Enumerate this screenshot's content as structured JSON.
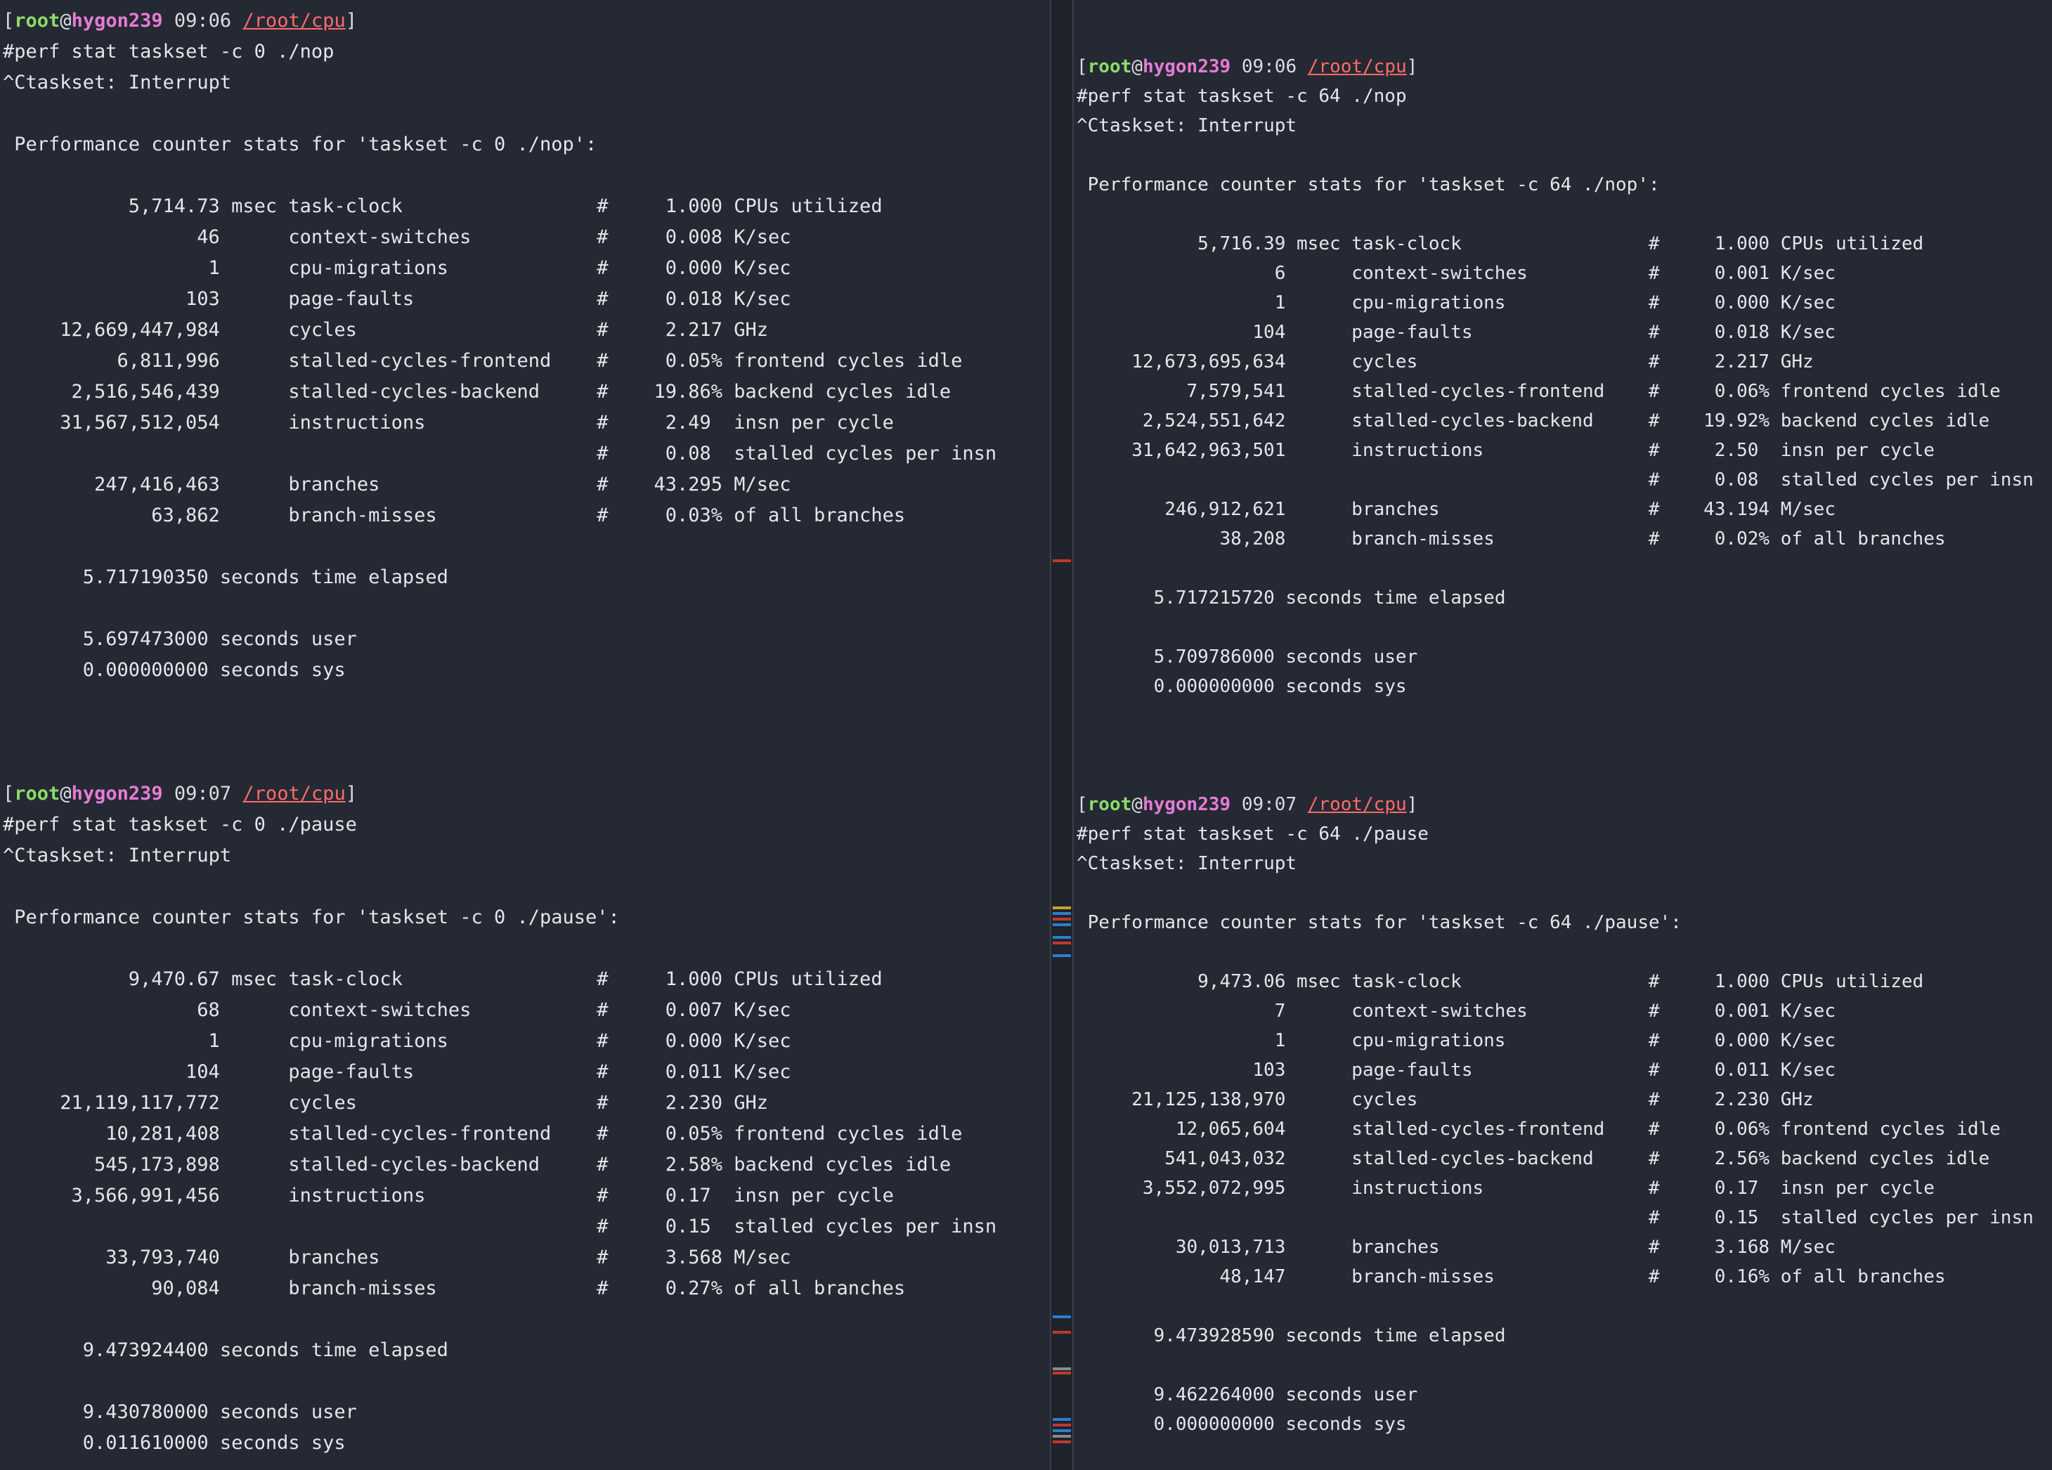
{
  "prompt": {
    "user": "root",
    "at": "@",
    "host": "hygon239",
    "path": "/root/cpu"
  },
  "panes": [
    {
      "runs": [
        {
          "time": "09:06",
          "command": "#perf stat taskset -c 0 ./nop",
          "interrupt": "^Ctaskset: Interrupt",
          "header": " Performance counter stats for 'taskset -c 0 ./nop':",
          "rows": [
            {
              "value": "5,714.73",
              "unit": "msec",
              "event": "task-clock",
              "hash": "#",
              "metric": "1.000",
              "desc": "CPUs utilized"
            },
            {
              "value": "46",
              "unit": "",
              "event": "context-switches",
              "hash": "#",
              "metric": "0.008",
              "desc": "K/sec"
            },
            {
              "value": "1",
              "unit": "",
              "event": "cpu-migrations",
              "hash": "#",
              "metric": "0.000",
              "desc": "K/sec"
            },
            {
              "value": "103",
              "unit": "",
              "event": "page-faults",
              "hash": "#",
              "metric": "0.018",
              "desc": "K/sec"
            },
            {
              "value": "12,669,447,984",
              "unit": "",
              "event": "cycles",
              "hash": "#",
              "metric": "2.217",
              "desc": "GHz"
            },
            {
              "value": "6,811,996",
              "unit": "",
              "event": "stalled-cycles-frontend",
              "hash": "#",
              "metric": "0.05%",
              "desc": "frontend cycles idle"
            },
            {
              "value": "2,516,546,439",
              "unit": "",
              "event": "stalled-cycles-backend",
              "hash": "#",
              "metric": "19.86%",
              "desc": "backend cycles idle"
            },
            {
              "value": "31,567,512,054",
              "unit": "",
              "event": "instructions",
              "hash": "#",
              "metric": "2.49",
              "desc": "insn per cycle"
            },
            {
              "value": "",
              "unit": "",
              "event": "",
              "hash": "#",
              "metric": "0.08",
              "desc": "stalled cycles per insn"
            },
            {
              "value": "247,416,463",
              "unit": "",
              "event": "branches",
              "hash": "#",
              "metric": "43.295",
              "desc": "M/sec"
            },
            {
              "value": "63,862",
              "unit": "",
              "event": "branch-misses",
              "hash": "#",
              "metric": "0.03%",
              "desc": "of all branches"
            }
          ],
          "elapsed": "5.717190350 seconds time elapsed",
          "user": "5.697473000 seconds user",
          "sys": "0.000000000 seconds sys"
        },
        {
          "time": "09:07",
          "command": "#perf stat taskset -c 0 ./pause",
          "interrupt": "^Ctaskset: Interrupt",
          "header": " Performance counter stats for 'taskset -c 0 ./pause':",
          "rows": [
            {
              "value": "9,470.67",
              "unit": "msec",
              "event": "task-clock",
              "hash": "#",
              "metric": "1.000",
              "desc": "CPUs utilized"
            },
            {
              "value": "68",
              "unit": "",
              "event": "context-switches",
              "hash": "#",
              "metric": "0.007",
              "desc": "K/sec"
            },
            {
              "value": "1",
              "unit": "",
              "event": "cpu-migrations",
              "hash": "#",
              "metric": "0.000",
              "desc": "K/sec"
            },
            {
              "value": "104",
              "unit": "",
              "event": "page-faults",
              "hash": "#",
              "metric": "0.011",
              "desc": "K/sec"
            },
            {
              "value": "21,119,117,772",
              "unit": "",
              "event": "cycles",
              "hash": "#",
              "metric": "2.230",
              "desc": "GHz"
            },
            {
              "value": "10,281,408",
              "unit": "",
              "event": "stalled-cycles-frontend",
              "hash": "#",
              "metric": "0.05%",
              "desc": "frontend cycles idle"
            },
            {
              "value": "545,173,898",
              "unit": "",
              "event": "stalled-cycles-backend",
              "hash": "#",
              "metric": "2.58%",
              "desc": "backend cycles idle"
            },
            {
              "value": "3,566,991,456",
              "unit": "",
              "event": "instructions",
              "hash": "#",
              "metric": "0.17",
              "desc": "insn per cycle"
            },
            {
              "value": "",
              "unit": "",
              "event": "",
              "hash": "#",
              "metric": "0.15",
              "desc": "stalled cycles per insn"
            },
            {
              "value": "33,793,740",
              "unit": "",
              "event": "branches",
              "hash": "#",
              "metric": "3.568",
              "desc": "M/sec"
            },
            {
              "value": "90,084",
              "unit": "",
              "event": "branch-misses",
              "hash": "#",
              "metric": "0.27%",
              "desc": "of all branches"
            }
          ],
          "elapsed": "9.473924400 seconds time elapsed",
          "user": "9.430780000 seconds user",
          "sys": "0.011610000 seconds sys"
        }
      ]
    },
    {
      "runs": [
        {
          "time": "09:06",
          "command": "#perf stat taskset -c 64 ./nop",
          "interrupt": "^Ctaskset: Interrupt",
          "header": " Performance counter stats for 'taskset -c 64 ./nop':",
          "rows": [
            {
              "value": "5,716.39",
              "unit": "msec",
              "event": "task-clock",
              "hash": "#",
              "metric": "1.000",
              "desc": "CPUs utilized"
            },
            {
              "value": "6",
              "unit": "",
              "event": "context-switches",
              "hash": "#",
              "metric": "0.001",
              "desc": "K/sec"
            },
            {
              "value": "1",
              "unit": "",
              "event": "cpu-migrations",
              "hash": "#",
              "metric": "0.000",
              "desc": "K/sec"
            },
            {
              "value": "104",
              "unit": "",
              "event": "page-faults",
              "hash": "#",
              "metric": "0.018",
              "desc": "K/sec"
            },
            {
              "value": "12,673,695,634",
              "unit": "",
              "event": "cycles",
              "hash": "#",
              "metric": "2.217",
              "desc": "GHz"
            },
            {
              "value": "7,579,541",
              "unit": "",
              "event": "stalled-cycles-frontend",
              "hash": "#",
              "metric": "0.06%",
              "desc": "frontend cycles idle"
            },
            {
              "value": "2,524,551,642",
              "unit": "",
              "event": "stalled-cycles-backend",
              "hash": "#",
              "metric": "19.92%",
              "desc": "backend cycles idle"
            },
            {
              "value": "31,642,963,501",
              "unit": "",
              "event": "instructions",
              "hash": "#",
              "metric": "2.50",
              "desc": "insn per cycle"
            },
            {
              "value": "",
              "unit": "",
              "event": "",
              "hash": "#",
              "metric": "0.08",
              "desc": "stalled cycles per insn"
            },
            {
              "value": "246,912,621",
              "unit": "",
              "event": "branches",
              "hash": "#",
              "metric": "43.194",
              "desc": "M/sec"
            },
            {
              "value": "38,208",
              "unit": "",
              "event": "branch-misses",
              "hash": "#",
              "metric": "0.02%",
              "desc": "of all branches"
            }
          ],
          "elapsed": "5.717215720 seconds time elapsed",
          "user": "5.709786000 seconds user",
          "sys": "0.000000000 seconds sys"
        },
        {
          "time": "09:07",
          "command": "#perf stat taskset -c 64 ./pause",
          "interrupt": "^Ctaskset: Interrupt",
          "header": " Performance counter stats for 'taskset -c 64 ./pause':",
          "rows": [
            {
              "value": "9,473.06",
              "unit": "msec",
              "event": "task-clock",
              "hash": "#",
              "metric": "1.000",
              "desc": "CPUs utilized"
            },
            {
              "value": "7",
              "unit": "",
              "event": "context-switches",
              "hash": "#",
              "metric": "0.001",
              "desc": "K/sec"
            },
            {
              "value": "1",
              "unit": "",
              "event": "cpu-migrations",
              "hash": "#",
              "metric": "0.000",
              "desc": "K/sec"
            },
            {
              "value": "103",
              "unit": "",
              "event": "page-faults",
              "hash": "#",
              "metric": "0.011",
              "desc": "K/sec"
            },
            {
              "value": "21,125,138,970",
              "unit": "",
              "event": "cycles",
              "hash": "#",
              "metric": "2.230",
              "desc": "GHz"
            },
            {
              "value": "12,065,604",
              "unit": "",
              "event": "stalled-cycles-frontend",
              "hash": "#",
              "metric": "0.06%",
              "desc": "frontend cycles idle"
            },
            {
              "value": "541,043,032",
              "unit": "",
              "event": "stalled-cycles-backend",
              "hash": "#",
              "metric": "2.56%",
              "desc": "backend cycles idle"
            },
            {
              "value": "3,552,072,995",
              "unit": "",
              "event": "instructions",
              "hash": "#",
              "metric": "0.17",
              "desc": "insn per cycle"
            },
            {
              "value": "",
              "unit": "",
              "event": "",
              "hash": "#",
              "metric": "0.15",
              "desc": "stalled cycles per insn"
            },
            {
              "value": "30,013,713",
              "unit": "",
              "event": "branches",
              "hash": "#",
              "metric": "3.168",
              "desc": "M/sec"
            },
            {
              "value": "48,147",
              "unit": "",
              "event": "branch-misses",
              "hash": "#",
              "metric": "0.16%",
              "desc": "of all branches"
            }
          ],
          "elapsed": "9.473928590 seconds time elapsed",
          "user": "9.462264000 seconds user",
          "sys": "0.000000000 seconds sys"
        }
      ]
    }
  ],
  "colors": {
    "background": "#252933",
    "text": "#e4e6eb",
    "prompt_user": "#8bdc66",
    "prompt_host": "#e77bd6",
    "prompt_path": "#ff6b6b"
  }
}
